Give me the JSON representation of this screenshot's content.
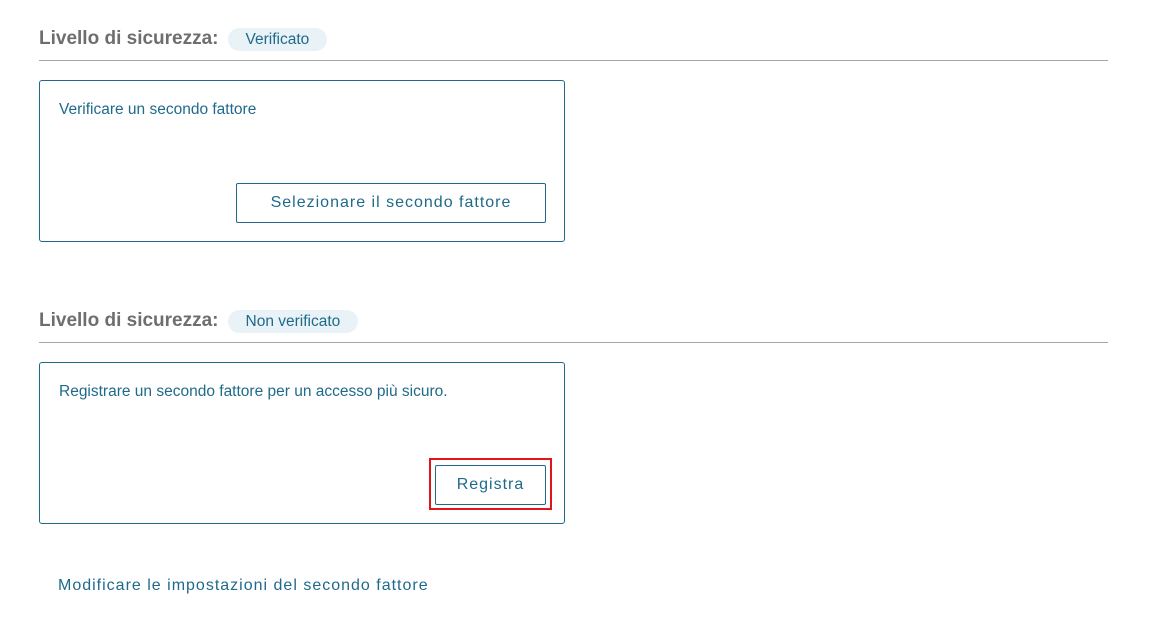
{
  "sections": [
    {
      "level_label": "Livello di sicurezza:",
      "badge": "Verificato",
      "card_text": "Verificare un secondo fattore",
      "button_label": "Selezionare il secondo fattore"
    },
    {
      "level_label": "Livello di sicurezza:",
      "badge": "Non verificato",
      "card_text": "Registrare un secondo fattore per un accesso più sicuro.",
      "button_label": "Registra"
    }
  ],
  "footer_link": "Modificare le impostazioni del secondo fattore",
  "colors": {
    "accent": "#1f6a8a",
    "badge_bg": "#e9f2f6",
    "label_gray": "#6e6e6e",
    "divider": "#a6a6a6",
    "highlight_red": "#e2151b"
  }
}
